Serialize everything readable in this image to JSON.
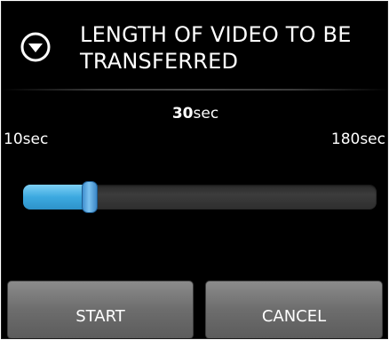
{
  "dialog": {
    "title": "LENGTH OF VIDEO TO BE TRANSFERRED",
    "title_icon": "chevron-down-circle-icon"
  },
  "slider": {
    "value": "30",
    "unit": "sec",
    "min_label": "10sec",
    "max_label": "180sec",
    "min_value": 10,
    "max_value": 180,
    "current_value": 30,
    "fill_color": "#3ca9e0"
  },
  "buttons": {
    "start_label": "START",
    "cancel_label": "CANCEL"
  }
}
